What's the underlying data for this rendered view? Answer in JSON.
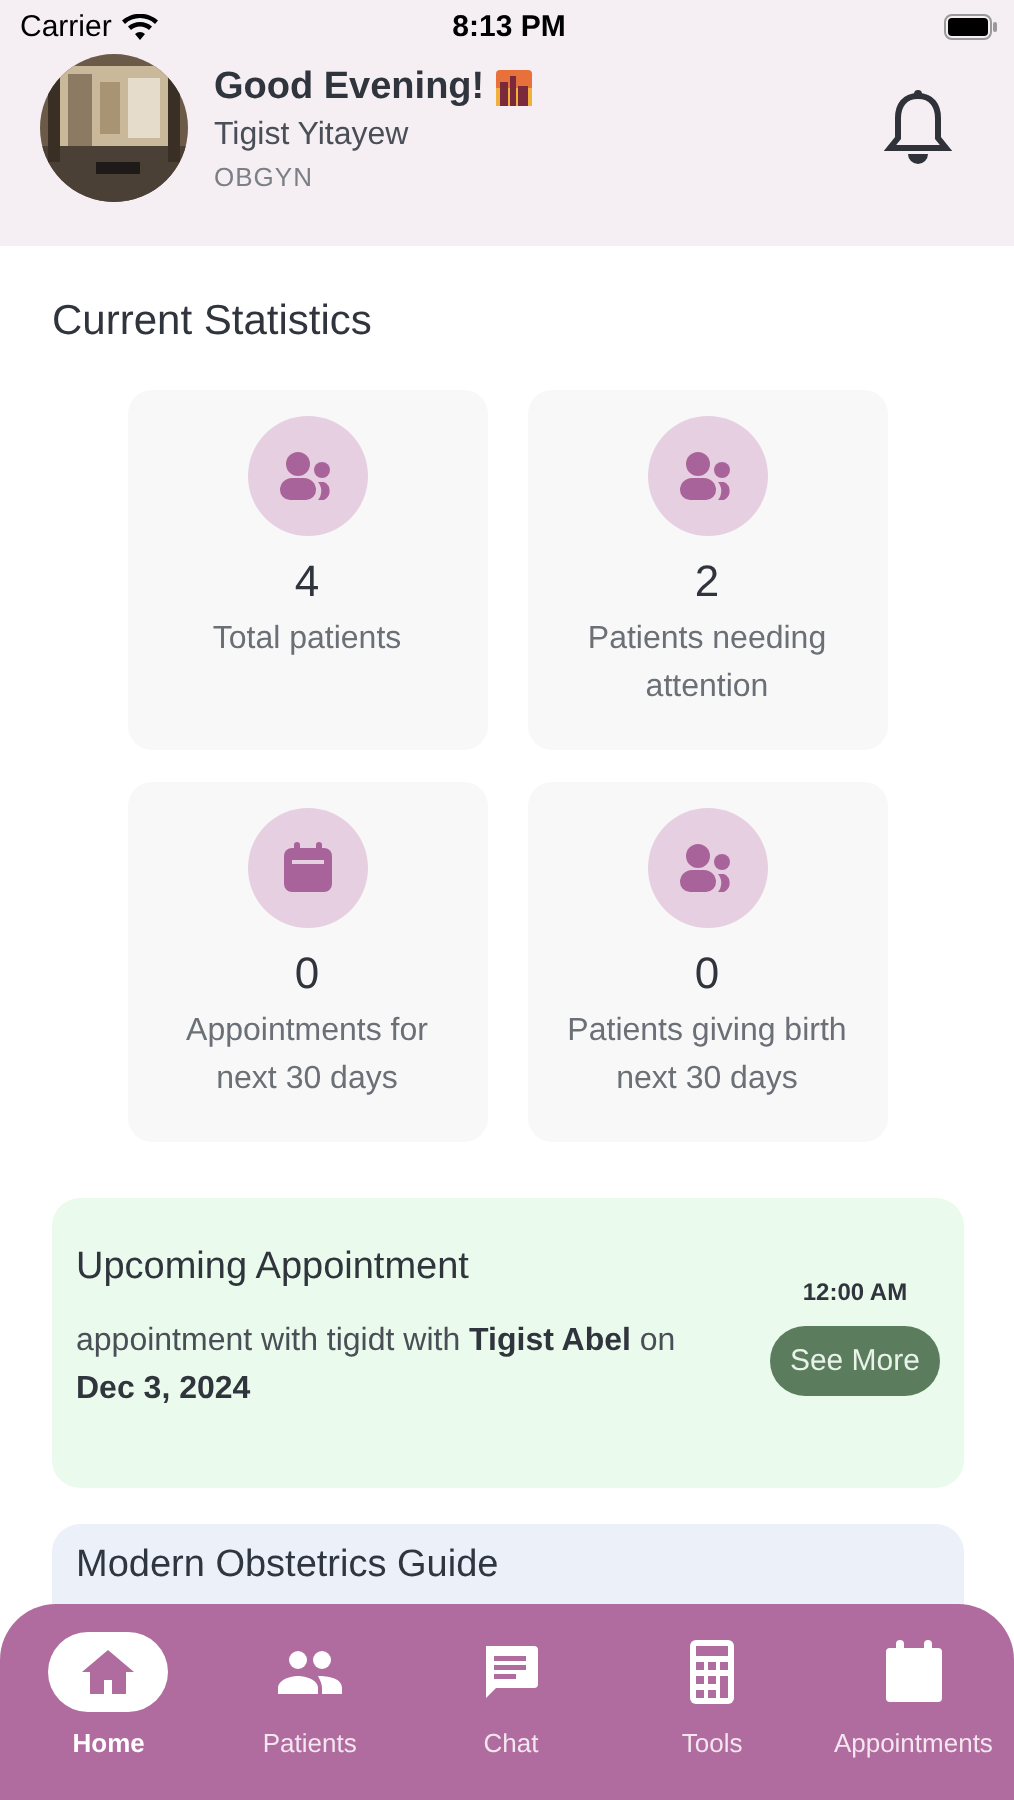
{
  "status_bar": {
    "carrier": "Carrier",
    "time": "8:13 PM"
  },
  "header": {
    "greeting": "Good Evening!",
    "name": "Tigist Yitayew",
    "role": "OBGYN"
  },
  "statistics": {
    "title": "Current Statistics",
    "cards": [
      {
        "kind": "patients",
        "value": "4",
        "label": "Total patients"
      },
      {
        "kind": "patients",
        "value": "2",
        "label": "Patients needing attention"
      },
      {
        "kind": "appointments",
        "value": "0",
        "label": "Appointments for next 30 days"
      },
      {
        "kind": "patients",
        "value": "0",
        "label": "Patients giving birth next 30 days"
      }
    ]
  },
  "upcoming_appointment": {
    "title": "Upcoming Appointment",
    "time": "12:00 AM",
    "description": "appointment with tigidt with **Tigist Abel** on **Dec 3, 2024**",
    "button": "See More"
  },
  "guide_card": {
    "title": "Modern Obstetrics Guide"
  },
  "tab_bar": [
    {
      "kind": "home",
      "label": "Home",
      "selected": true
    },
    {
      "kind": "people",
      "label": "Patients",
      "selected": false
    },
    {
      "kind": "chat",
      "label": "Chat",
      "selected": false
    },
    {
      "kind": "calculator",
      "label": "Tools",
      "selected": false
    },
    {
      "kind": "calendar",
      "label": "Appointments",
      "selected": false
    }
  ]
}
